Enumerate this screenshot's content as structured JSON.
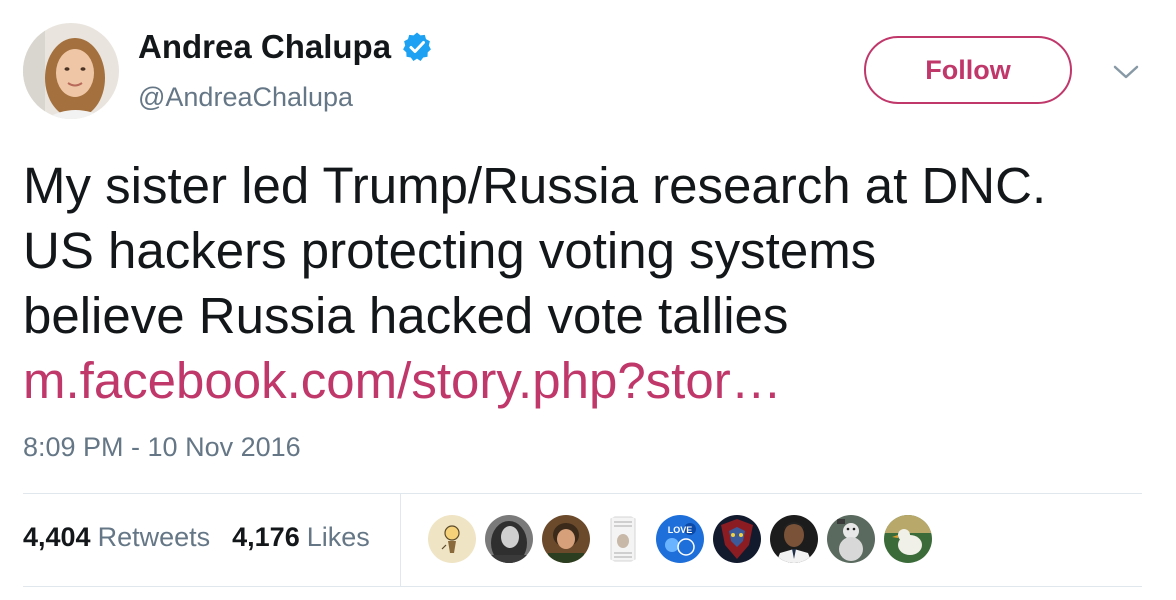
{
  "author": {
    "name": "Andrea Chalupa",
    "handle": "@AndreaChalupa",
    "verified": true
  },
  "follow_button": {
    "label": "Follow"
  },
  "tweet": {
    "text_lines": [
      "My sister led Trump/Russia research at DNC.",
      "US hackers protecting voting systems",
      "believe Russia hacked vote tallies"
    ],
    "link_text": "m.facebook.com/story.php?stor…",
    "timestamp": "8:09 PM - 10 Nov 2016"
  },
  "stats": {
    "retweets_count": "4,404",
    "retweets_label": "Retweets",
    "likes_count": "4,176",
    "likes_label": "Likes"
  },
  "likers": [
    "cartoon-avatar",
    "woman-avatar",
    "person-avatar",
    "document-cat-avatar",
    "love-blue-avatar",
    "superhero-avatar",
    "man-avatar",
    "snowman-avatar",
    "bird-avatar"
  ],
  "colors": {
    "accent": "#c0376a",
    "verified": "#1da1f2",
    "muted": "#657786",
    "text": "#14171a",
    "border": "#e1e8ed"
  }
}
